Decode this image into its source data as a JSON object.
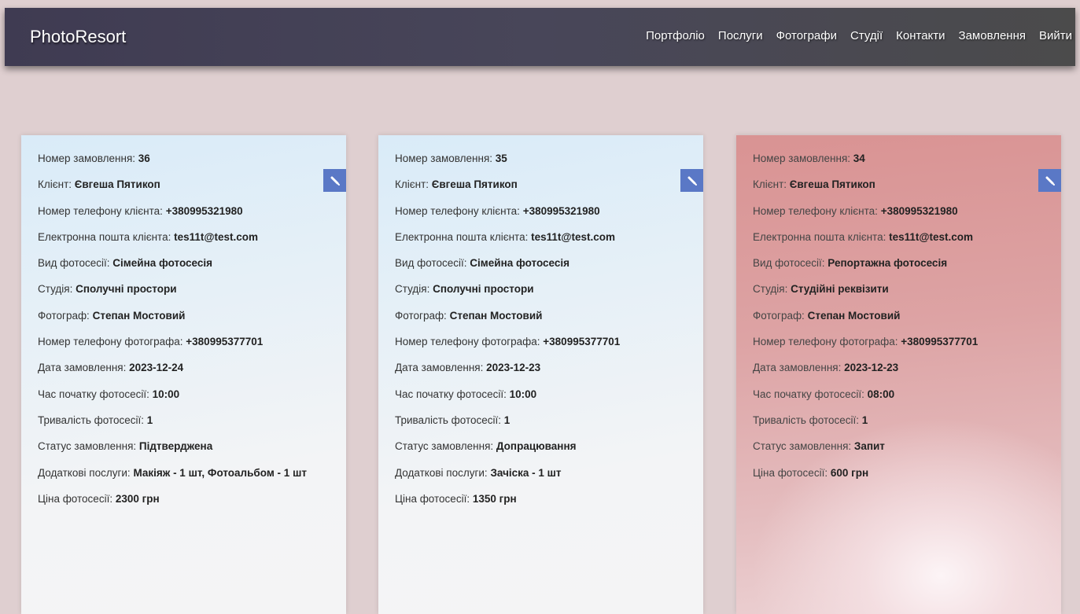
{
  "nav": {
    "brand": "PhotoResort",
    "links": [
      "Портфоліо",
      "Послуги",
      "Фотографи",
      "Студії",
      "Контакти",
      "Замовлення",
      "Вийти"
    ]
  },
  "orders": [
    {
      "fields": [
        {
          "label": "Номер замовлення: ",
          "value": "36"
        },
        {
          "label": "Клієнт: ",
          "value": "Євгеша Пятикоп"
        },
        {
          "label": "Номер телефону клієнта: ",
          "value": "+380995321980"
        },
        {
          "label": "Електронна пошта клієнта: ",
          "value": "tes11t@test.com"
        },
        {
          "label": "Вид фотосесії: ",
          "value": "Сімейна фотосесія"
        },
        {
          "label": "Студія: ",
          "value": "Сполучні простори"
        },
        {
          "label": "Фотограф: ",
          "value": "Степан Мостовий"
        },
        {
          "label": "Номер телефону фотографа: ",
          "value": "+380995377701"
        },
        {
          "label": "Дата замовлення: ",
          "value": "2023-12-24"
        },
        {
          "label": "Час початку фотосесії: ",
          "value": "10:00"
        },
        {
          "label": "Тривалість фотосесії: ",
          "value": "1"
        },
        {
          "label": "Статус замовлення: ",
          "value": "Підтверджена"
        },
        {
          "label": "Додаткові послуги: ",
          "value": "Макіяж - 1 шт, Фотоальбом - 1 шт"
        },
        {
          "label": "Ціна фотосесії: ",
          "value": "2300 грн"
        }
      ]
    },
    {
      "fields": [
        {
          "label": "Номер замовлення: ",
          "value": "35"
        },
        {
          "label": "Клієнт: ",
          "value": "Євгеша Пятикоп"
        },
        {
          "label": "Номер телефону клієнта: ",
          "value": "+380995321980"
        },
        {
          "label": "Електронна пошта клієнта: ",
          "value": "tes11t@test.com"
        },
        {
          "label": "Вид фотосесії: ",
          "value": "Сімейна фотосесія"
        },
        {
          "label": "Студія: ",
          "value": "Сполучні простори"
        },
        {
          "label": "Фотограф: ",
          "value": "Степан Мостовий"
        },
        {
          "label": "Номер телефону фотографа: ",
          "value": "+380995377701"
        },
        {
          "label": "Дата замовлення: ",
          "value": "2023-12-23"
        },
        {
          "label": "Час початку фотосесії: ",
          "value": "10:00"
        },
        {
          "label": "Тривалість фотосесії: ",
          "value": "1"
        },
        {
          "label": "Статус замовлення: ",
          "value": "Допрацювання"
        },
        {
          "label": "Додаткові послуги: ",
          "value": "Зачіска - 1 шт"
        },
        {
          "label": "Ціна фотосесії: ",
          "value": "1350 грн"
        }
      ]
    },
    {
      "fields": [
        {
          "label": "Номер замовлення: ",
          "value": "34"
        },
        {
          "label": "Клієнт: ",
          "value": "Євгеша Пятикоп"
        },
        {
          "label": "Номер телефону клієнта: ",
          "value": "+380995321980"
        },
        {
          "label": "Електронна пошта клієнта: ",
          "value": "tes11t@test.com"
        },
        {
          "label": "Вид фотосесії: ",
          "value": "Репортажна фотосесія"
        },
        {
          "label": "Студія: ",
          "value": "Студійні реквізити"
        },
        {
          "label": "Фотограф: ",
          "value": "Степан Мостовий"
        },
        {
          "label": "Номер телефону фотографа: ",
          "value": "+380995377701"
        },
        {
          "label": "Дата замовлення: ",
          "value": "2023-12-23"
        },
        {
          "label": "Час початку фотосесії: ",
          "value": "08:00"
        },
        {
          "label": "Тривалість фотосесії: ",
          "value": "1"
        },
        {
          "label": "Статус замовлення: ",
          "value": "Запит"
        },
        {
          "label": "Ціна фотосесії: ",
          "value": "600 грн"
        }
      ]
    }
  ],
  "colors": {
    "accent": "#5a78c6",
    "navbar": "#484659",
    "background": "#dfcfd0",
    "card_pending": "#d99393",
    "card_default": "#d9ebf8"
  },
  "icons": {
    "edit": "pencil-icon"
  }
}
